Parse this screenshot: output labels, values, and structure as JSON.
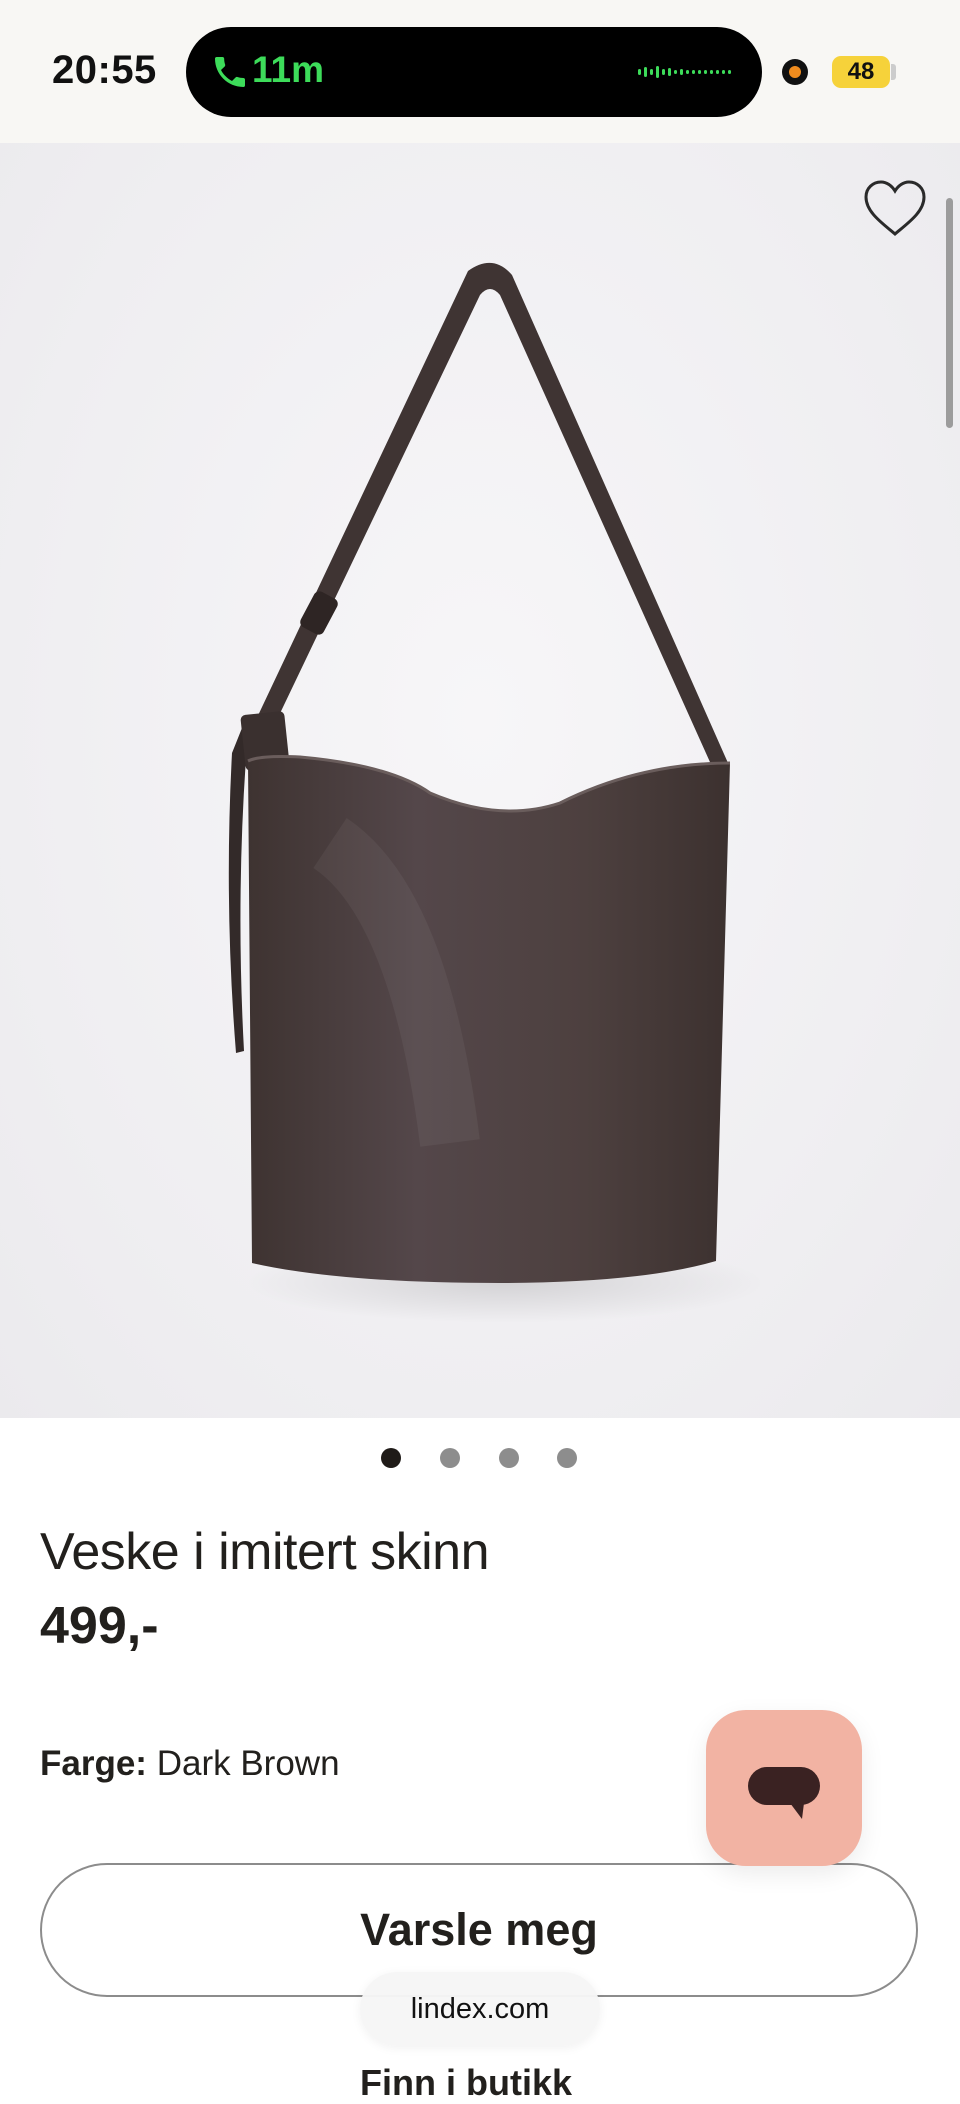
{
  "status_bar": {
    "time": "20:55",
    "call_duration": "11m",
    "battery": "48",
    "call_color": "#3ddc5a",
    "battery_color": "#f6d23a"
  },
  "product": {
    "title": "Veske i imitert skinn",
    "price": "499,-",
    "color_label": "Farge:",
    "color_value": "Dark Brown",
    "bag_color": "#4a3c3a",
    "image_dots": 4,
    "active_dot": 1
  },
  "actions": {
    "notify_label": "Varsle meg",
    "partial_text": "Finn i butikk"
  },
  "chat": {
    "icon": "chat-bubble-icon",
    "accent": "#f2b3a3"
  },
  "browser": {
    "url": "lindex.com"
  }
}
